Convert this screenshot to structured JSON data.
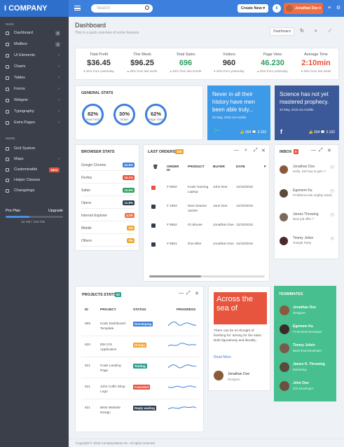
{
  "app": {
    "brand": "I COMPANY",
    "search_placeholder": "Search",
    "create_label": "Create New ▾",
    "notif_count": "6",
    "user_name": "Jonathan Doe ▾"
  },
  "sidebar": {
    "main_head": "MAIN",
    "items": [
      {
        "label": "Dashboard",
        "badge": "6"
      },
      {
        "label": "Mailbox",
        "badge": "2"
      },
      {
        "label": "UI Elements",
        "badge": "›"
      },
      {
        "label": "Charts",
        "badge": "›"
      },
      {
        "label": "Tables",
        "badge": "›"
      },
      {
        "label": "Forms",
        "badge": "›"
      },
      {
        "label": "Widgets",
        "badge": "›"
      },
      {
        "label": "Typography",
        "badge": "›"
      },
      {
        "label": "Extra Pages",
        "badge": "›"
      }
    ],
    "more_head": "MORE",
    "more_items": [
      {
        "label": "Grid System",
        "badge": ""
      },
      {
        "label": "Maps",
        "badge": "›"
      },
      {
        "label": "Customizable",
        "badge": "NEW"
      },
      {
        "label": "Helper Classes",
        "badge": ""
      },
      {
        "label": "Changelogs",
        "badge": ""
      }
    ],
    "plan_label": "Pro Plan",
    "upgrade_label": "Upgrade",
    "plan_usage": "42 GB / 100 GB",
    "plan_fraction": 0.42
  },
  "header": {
    "title": "Dashboard",
    "subtitle": "This is a quick overview of some features",
    "crumb": "Dashboard"
  },
  "stats": [
    {
      "label": "Total Profit",
      "value": "$36.45",
      "color": "#333333",
      "delta": "▾ 26% from yesterday"
    },
    {
      "label": "This Week",
      "value": "$96.25",
      "color": "#333333",
      "delta": "▴ 26% from last week"
    },
    {
      "label": "Total Sales",
      "value": "696",
      "color": "#2e9e5f",
      "delta": "▴ 26% from last month"
    },
    {
      "label": "Visitors",
      "value": "960",
      "color": "#333333",
      "delta": "▾ 26% from yesterday"
    },
    {
      "label": "Page View",
      "value": "46.230",
      "color": "#2e9e5f",
      "delta": "▴ 26% from yesterday"
    },
    {
      "label": "Average Time",
      "value": "2:10min",
      "color": "#e8513c",
      "delta": "▾ 26% from last week"
    }
  ],
  "general_stats": {
    "title": "GENERAL STATS",
    "gauges": [
      {
        "value": "82%",
        "label": "New Visit"
      },
      {
        "value": "30%",
        "label": "Order"
      },
      {
        "value": "62%",
        "label": "Page View"
      }
    ]
  },
  "quotes": [
    {
      "text": "Never in all their history have men been able truly...",
      "date": "22 May, 2015 via mobile",
      "likes": "694",
      "comments": "2.192"
    },
    {
      "text": "Science has not yet mastered prophecy.",
      "date": "22 May, 2015 via mobile",
      "likes": "694",
      "comments": "2.192"
    }
  ],
  "browser_stats": {
    "title": "BROWSER STATS",
    "rows": [
      {
        "name": "Google Chrome",
        "pct": "42.8%",
        "color": "#3d7fdc"
      },
      {
        "name": "Firefox",
        "pct": "16.1%",
        "color": "#e8513c"
      },
      {
        "name": "Safari",
        "pct": "15.5%",
        "color": "#2e9e5f"
      },
      {
        "name": "Opera",
        "pct": "11.8%",
        "color": "#2c3e50"
      },
      {
        "name": "Internet Explorer",
        "pct": "3.2%",
        "color": "#f06e44"
      },
      {
        "name": "Mobile",
        "pct": "3%",
        "color": "#f0a42f"
      },
      {
        "name": "Others",
        "pct": "0%",
        "color": "#f0a42f"
      }
    ]
  },
  "orders": {
    "title": "LAST ORDERS",
    "count": "196",
    "headers": [
      "ORDER ID",
      "PRODUCT",
      "BUYER",
      "DATE",
      "F"
    ],
    "rows": [
      {
        "color": "#e8513c",
        "id": "# 9652",
        "product": "Kode Gaming Laptop",
        "buyer": "John Doe",
        "date": "12/10/2015"
      },
      {
        "color": "#2c3e50",
        "id": "# 1963",
        "product": "New Season Jacket",
        "buyer": "Jane Doe",
        "date": "12/10/2015"
      },
      {
        "color": "#2c3e50",
        "id": "# 9652",
        "product": "IO Mouse",
        "buyer": "Jonathan Doe",
        "date": "12/10/2015"
      },
      {
        "color": "#2c3e50",
        "id": "# 9651",
        "product": "Doe Bike",
        "buyer": "Jonathan Doe",
        "date": "12/10/2015"
      }
    ]
  },
  "inbox": {
    "title": "INBOX",
    "count": "9",
    "messages": [
      {
        "name": "Jonathan Doe",
        "msg": "Hello, m8 how is goin ?",
        "color": "#8a5a3c"
      },
      {
        "name": "Egemem Ka",
        "msg": "Problems look mighty small...",
        "color": "#5a4a3c"
      },
      {
        "name": "James Throwing",
        "msg": "New job offer ?",
        "color": "#7a6a5c"
      },
      {
        "name": "Timmy Jefsin",
        "msg": "Tonight Party",
        "color": "#4a2a2c"
      }
    ]
  },
  "projects": {
    "title": "PROJECTS STATS",
    "count": "62",
    "headers": [
      "ID",
      "PROJECT",
      "STATUS",
      "PROGRESS"
    ],
    "rows": [
      {
        "id": "965",
        "project": "Kode Dashboard Template",
        "status": "Developing",
        "color": "#3d7fdc"
      },
      {
        "id": "620",
        "project": "EBI iOS Application",
        "status": "Design",
        "color": "#f0a42f"
      },
      {
        "id": "621",
        "project": "Kode Landing Page",
        "status": "Testing",
        "color": "#2e9e8f"
      },
      {
        "id": "621",
        "project": "John Coffe Shop Logo",
        "status": "Canceled",
        "color": "#e8513c"
      },
      {
        "id": "621",
        "project": "BKM Website Design",
        "status": "Reply waiting",
        "color": "#2c3e50"
      }
    ]
  },
  "article": {
    "image_text": "Across the sea of",
    "body": "There can be no thought of finishing for 'aiming for the stars.' Both figuratively and literally...",
    "read_more": "Read More",
    "author": "Jonathan Doe",
    "author_role": "Designer"
  },
  "teammates": {
    "title": "TEAMMATES",
    "members": [
      {
        "name": "Jonathan Doe",
        "role": "Designer",
        "color": "#8a5a3c"
      },
      {
        "name": "Egemem Ka",
        "role": "Front-End Developer",
        "color": "#3a2a2c"
      },
      {
        "name": "Timmy Jefsin",
        "role": "Back-End Developer",
        "color": "#7a5a4c"
      },
      {
        "name": "James K. Throwing",
        "role": "Marketing",
        "color": "#5a4a3c"
      },
      {
        "name": "John Doe",
        "role": "iOS Developer",
        "color": "#6a5040"
      }
    ]
  },
  "footer": "Copyright © 2016 CompanyName inc. All rights reserved"
}
